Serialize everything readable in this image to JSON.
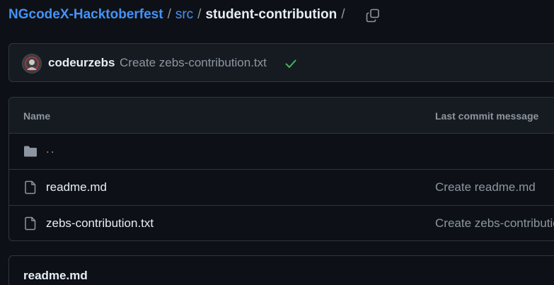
{
  "breadcrumb": {
    "repo": "NGcodeX-Hacktoberfest",
    "folder": "src",
    "current": "student-contribution",
    "separator": "/",
    "copy_icon": "copy-icon"
  },
  "latest_commit": {
    "author": "codeurzebs",
    "message": "Create zebs-contribution.txt",
    "status_icon": "check-icon",
    "status_color": "#3fb950"
  },
  "file_table": {
    "columns": [
      "Name",
      "Last commit message"
    ],
    "rows": [
      {
        "name": "..",
        "icon": "folder-icon",
        "message": ""
      },
      {
        "name": "readme.md",
        "icon": "file-icon",
        "message": "Create readme.md"
      },
      {
        "name": "zebs-contribution.txt",
        "icon": "file-icon",
        "message": "Create zebs-contribution.txt"
      }
    ]
  },
  "readme": {
    "title": "readme.md"
  },
  "colors": {
    "background": "#0d1117",
    "link": "#4493f8",
    "muted": "#8d96a0",
    "border": "#30363d"
  }
}
